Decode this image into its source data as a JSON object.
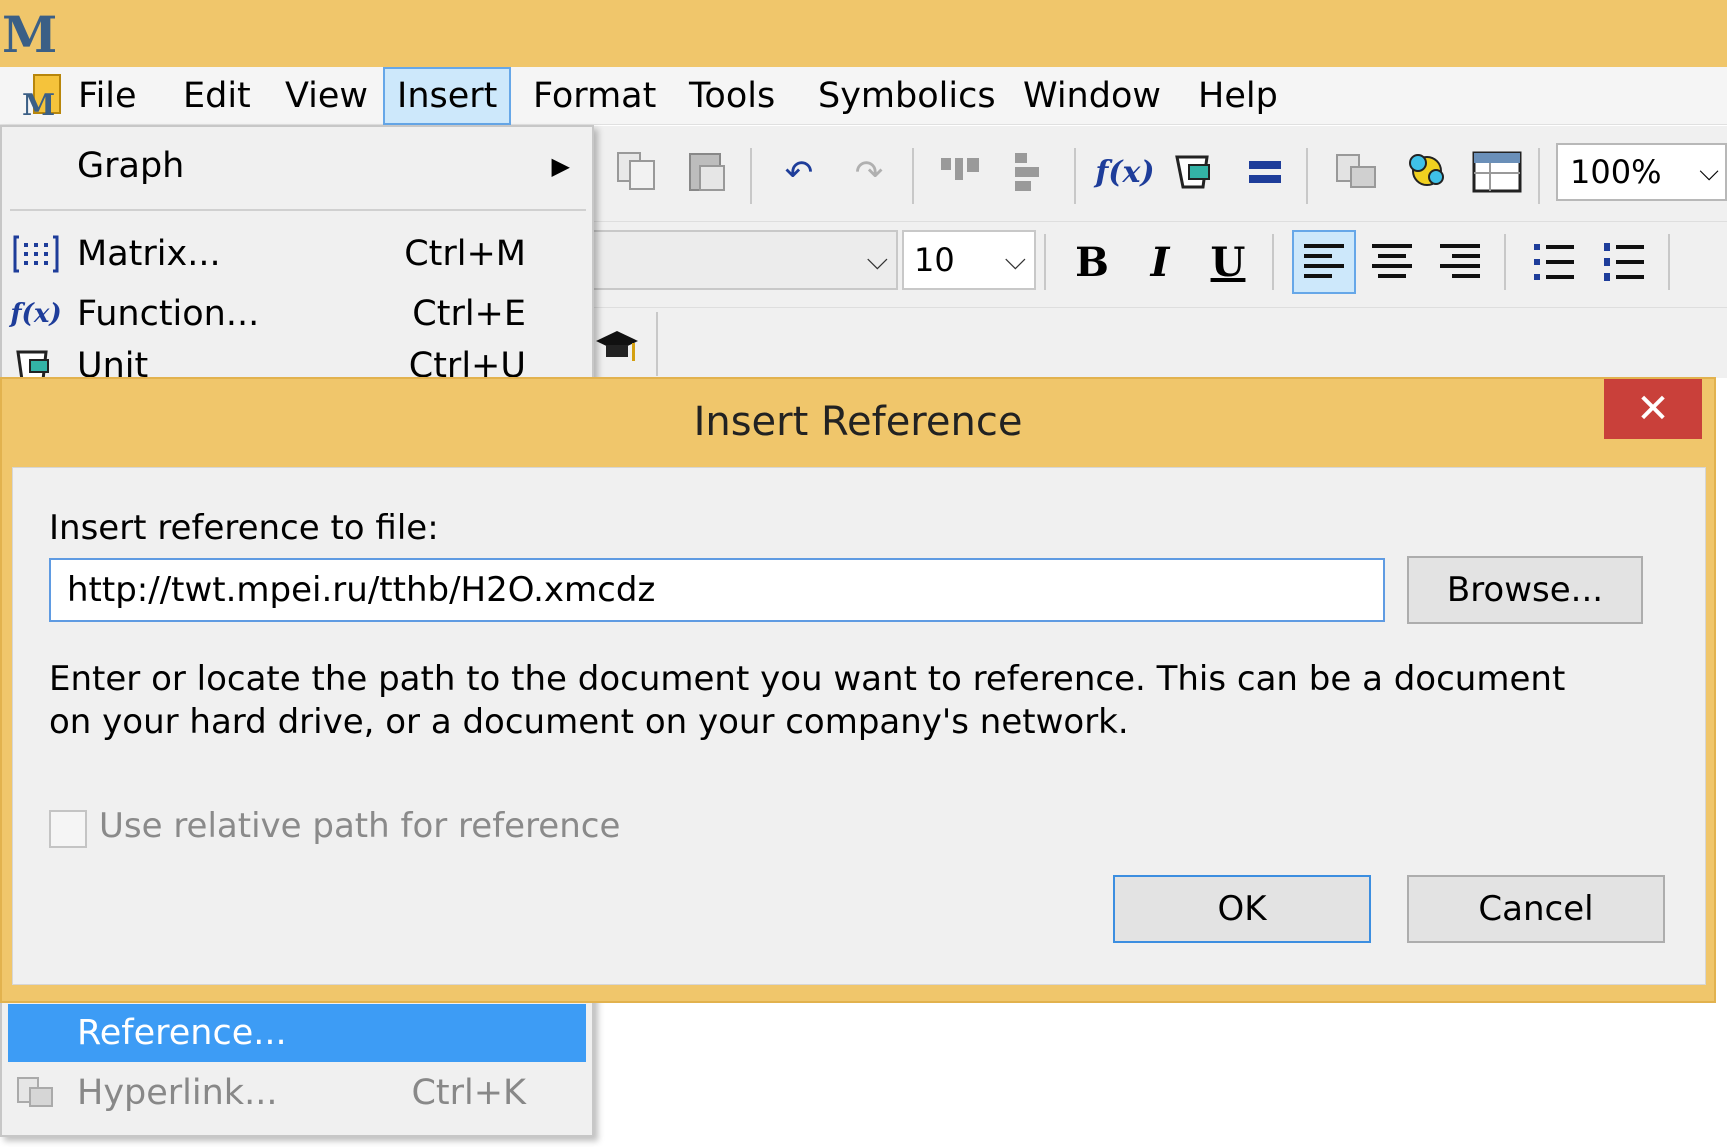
{
  "app": {
    "logo_letter": "M"
  },
  "menubar": {
    "items": [
      {
        "label": "File"
      },
      {
        "label": "Edit"
      },
      {
        "label": "View"
      },
      {
        "label": "Insert"
      },
      {
        "label": "Format"
      },
      {
        "label": "Tools"
      },
      {
        "label": "Symbolics"
      },
      {
        "label": "Window"
      },
      {
        "label": "Help"
      }
    ],
    "active": "Insert"
  },
  "toolbar": {
    "zoom": "100%",
    "font_size": "10",
    "bold_label": "B",
    "italic_label": "I",
    "underline_label": "U",
    "function_icon_label": "f(x)"
  },
  "insert_menu": {
    "items": [
      {
        "label": "Graph",
        "shortcut": "",
        "icon": "graph"
      },
      {
        "label": "Matrix...",
        "shortcut": "Ctrl+M",
        "icon": "matrix-icon"
      },
      {
        "label": "Function...",
        "shortcut": "Ctrl+E",
        "icon": "function-icon"
      },
      {
        "label": "Unit",
        "shortcut": "Ctrl+U",
        "icon": "unit-icon"
      },
      {
        "label": "Reference...",
        "shortcut": "",
        "icon": ""
      },
      {
        "label": "Hyperlink...",
        "shortcut": "Ctrl+K",
        "icon": "hyperlink-icon"
      }
    ],
    "highlighted": "Reference..."
  },
  "dialog": {
    "title": "Insert Reference",
    "file_label": "Insert reference to file:",
    "path_value": "http://twt.mpei.ru/tthb/H2O.xmcdz",
    "browse_label": "Browse...",
    "description_line1": "Enter or locate the path to the document you want to reference. This can be a document",
    "description_line2": "on your hard drive, or a document on your company's network.",
    "relative_path_label": "Use relative path for reference",
    "relative_path_checked": false,
    "ok_label": "OK",
    "cancel_label": "Cancel"
  },
  "colors": {
    "title_bar": "#f0c66b",
    "close_button": "#c9403a",
    "menu_highlight": "#3d9cf5",
    "focus_border": "#3c8ee0"
  }
}
